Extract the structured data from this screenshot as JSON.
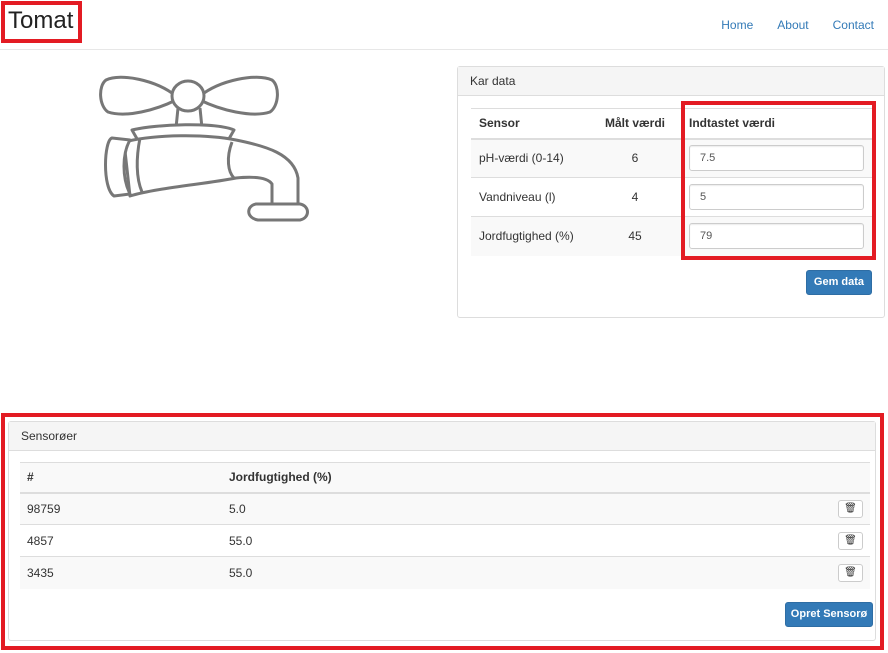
{
  "brand": "Tomat",
  "nav": {
    "home": "Home",
    "about": "About",
    "contact": "Contact"
  },
  "image": {
    "icon": "faucet-icon"
  },
  "kar_data": {
    "heading": "Kar data",
    "columns": [
      "Sensor",
      "Målt værdi",
      "Indtastet værdi"
    ],
    "rows": [
      {
        "sensor": "pH-værdi (0-14)",
        "measured": "6",
        "entered": "7.5"
      },
      {
        "sensor": "Vandniveau (l)",
        "measured": "4",
        "entered": "5"
      },
      {
        "sensor": "Jordfugtighed (%)",
        "measured": "45",
        "entered": "79"
      }
    ],
    "save_button": "Gem data"
  },
  "sensoroer": {
    "heading": "Sensorøer",
    "columns": [
      "#",
      "Jordfugtighed (%)"
    ],
    "rows": [
      {
        "id": "98759",
        "value": "5.0"
      },
      {
        "id": "4857",
        "value": "55.0"
      },
      {
        "id": "3435",
        "value": "55.0"
      }
    ],
    "delete_icon": "trash-icon",
    "create_button": "Opret Sensorø"
  },
  "colors": {
    "highlight": "#e31b23",
    "primary": "#337ab7",
    "link": "#337ab7"
  }
}
